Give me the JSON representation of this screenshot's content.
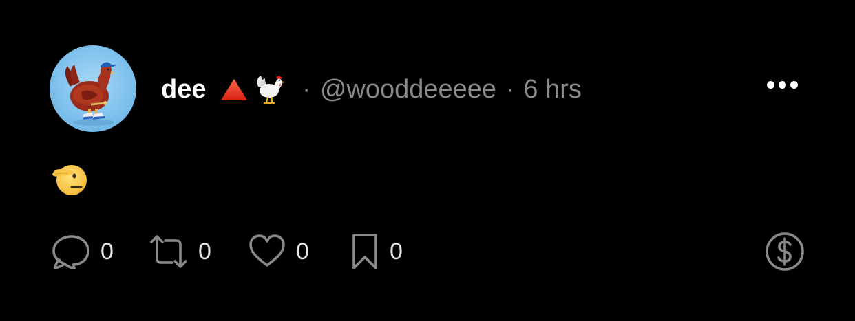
{
  "post": {
    "display_name": "dee",
    "separator": "·",
    "handle": "@wooddeeeee",
    "time": "6 hrs",
    "body_emoji": "saluting-face"
  },
  "actions": {
    "reply_count": "0",
    "repost_count": "0",
    "like_count": "0",
    "bookmark_count": "0"
  },
  "colors": {
    "background": "#000000",
    "primary_text": "#ffffff",
    "secondary_text": "#8a8a8e",
    "icon": "#8a8a8e"
  },
  "icons": [
    "chicken-avatar",
    "red-triangle-icon",
    "rooster-icon",
    "more-icon",
    "reply-icon",
    "repost-icon",
    "like-icon",
    "bookmark-icon",
    "tip-icon"
  ]
}
